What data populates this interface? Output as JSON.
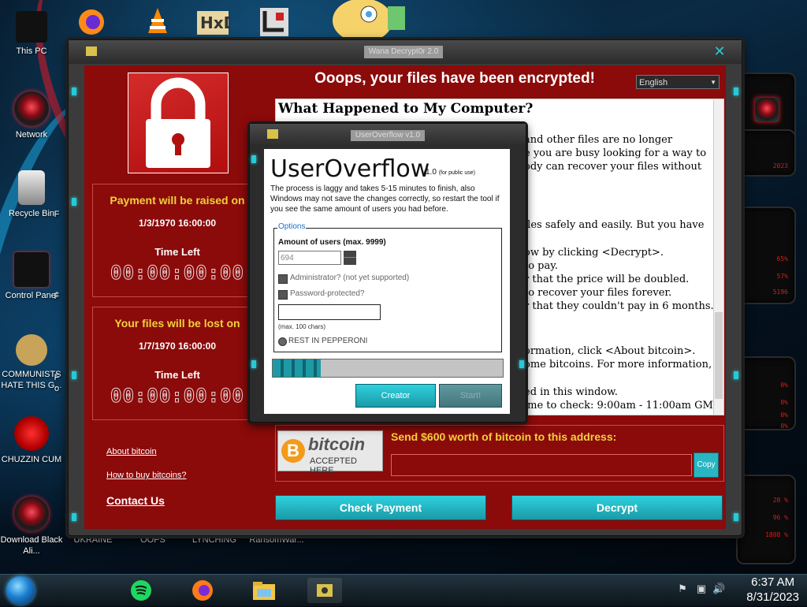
{
  "desktop": {
    "icons": [
      {
        "label": "This PC"
      },
      {
        "label": "Network"
      },
      {
        "label": "Recycle Bin"
      },
      {
        "label": "Control Panel"
      },
      {
        "label": "COMMUNISTS HATE THIS G..."
      },
      {
        "label": "CHUZZIN CUM"
      },
      {
        "label": "Download Black Ali..."
      }
    ],
    "partial_labels": [
      "F",
      "F",
      "F",
      "o",
      "UKRAINE",
      "OOPS",
      "LYNCHING",
      "RansomWar..."
    ],
    "widget_values": [
      "2023",
      "65%",
      "57%",
      "5196",
      "0%",
      "0%",
      "0%",
      "0%",
      "28 %",
      "96 %",
      "1808 %"
    ]
  },
  "wannacry": {
    "title": "Wana Decrypt0r 2.0",
    "headline": "Ooops, your files have been encrypted!",
    "language": "English",
    "raise_panel": {
      "title": "Payment will be raised on",
      "date": "1/3/1970 16:00:00",
      "time_left_label": "Time Left",
      "timer": "00:00:00:00"
    },
    "lost_panel": {
      "title": "Your files will be lost on",
      "date": "1/7/1970 16:00:00",
      "time_left_label": "Time Left",
      "timer": "00:00:00:00"
    },
    "links": {
      "about": "About bitcoin",
      "how_to_buy": "How to buy bitcoins?",
      "contact": "Contact Us"
    },
    "text_heading": "What Happened to My Computer?",
    "text_lines": [
      "and other files are no longer",
      "e you are busy looking for a way to",
      "ody can recover your files without",
      "iles safely and easily. But you have",
      "ow by clicking <Decrypt>.",
      "to pay.",
      "r that the price will be doubled.",
      "to recover your files forever.",
      "r that they couldn't pay in 6 months.",
      "ormation, click <About bitcoin>.",
      "ome bitcoins. For more information,",
      "ed in this window.",
      "ime to check: 9:00am - 11:00am GMT"
    ],
    "bitcoin": {
      "logo_text": "bitcoin",
      "accepted": "ACCEPTED HERE",
      "send_text": "Send $600 worth of bitcoin to this address:",
      "address": "",
      "copy": "Copy"
    },
    "buttons": {
      "check_payment": "Check Payment",
      "decrypt": "Decrypt"
    }
  },
  "userOverflow": {
    "title": "UserOverflow v1.0",
    "app_name": "UserOverflow",
    "version": "v1.0",
    "version_note": "(for public use)",
    "description": "The process is laggy and takes 5-15 minutes to finish, also Windows may not save the changes correctly, so restart the tool if you see the same amount of users you had before.",
    "options_legend": "Options",
    "amount_label": "Amount of users (max. 9999)",
    "amount_value": "694",
    "admin_label": "Administrator? (not yet supported)",
    "password_label": "Password-protected?",
    "password_value": "",
    "password_hint": "(max. 100 chars)",
    "radio_label": "REST IN PEPPERONI",
    "progress": 0.21,
    "buttons": {
      "creator": "Creator",
      "start": "Start!"
    }
  },
  "taskbar": {
    "time": "6:37 AM",
    "date": "8/31/2023"
  },
  "colors": {
    "wannacry_red": "#8b0a0a",
    "accent_teal": "#27c9d6",
    "headline_yellow": "#f0d23a"
  }
}
